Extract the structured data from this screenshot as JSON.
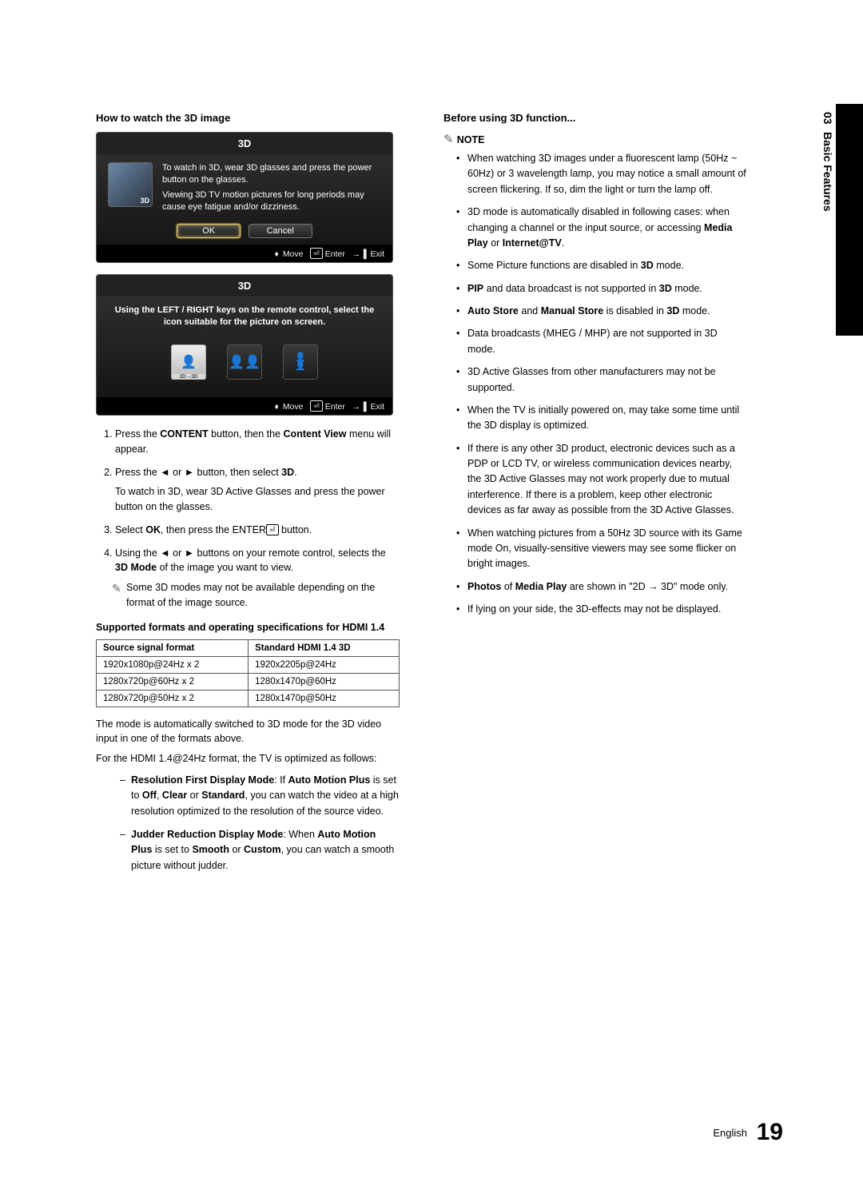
{
  "chapter": {
    "num": "03",
    "label": "Basic Features"
  },
  "left": {
    "heading": "How to watch the 3D image",
    "dialog1": {
      "title": "3D",
      "line1": "To watch in 3D, wear 3D glasses and press the power button on the glasses.",
      "line2": "Viewing 3D TV motion pictures for long periods may cause eye fatigue and/or dizziness.",
      "ok": "OK",
      "cancel": "Cancel",
      "footer_move": "Move",
      "footer_enter": "Enter",
      "footer_exit": "Exit"
    },
    "dialog2": {
      "title": "3D",
      "text": "Using the LEFT / RIGHT keys on the remote control, select the icon suitable for the picture on screen.",
      "footer_move": "Move",
      "footer_enter": "Enter",
      "footer_exit": "Exit",
      "icon1": "2d-to-3d-icon",
      "icon2": "side-by-side-icon",
      "icon3": "top-bottom-icon"
    },
    "steps": [
      {
        "pre": "Press the ",
        "b1": "CONTENT",
        "mid": " button, then the ",
        "b2": "Content View",
        "post": " menu will appear."
      },
      {
        "text": "Press the ◄ or ► button, then select ",
        "b": "3D",
        "post2": ".",
        "extra": "To watch in 3D, wear 3D Active Glasses and press the power button on the glasses."
      },
      {
        "pre": "Select ",
        "b1": "OK",
        "mid": ", then press the ENTER",
        "post": " button."
      },
      {
        "pre": "Using the ◄ or ► buttons on your remote control, selects the ",
        "b1": "3D Mode",
        "post": " of the image you want to view.",
        "subnote": "Some 3D modes may not be available depending on the format of the image source."
      }
    ],
    "formats_heading": "Supported formats and operating specifications for HDMI 1.4",
    "table": {
      "h1": "Source signal format",
      "h2": "Standard HDMI 1.4 3D",
      "rows": [
        [
          "1920x1080p@24Hz x 2",
          "1920x2205p@24Hz"
        ],
        [
          "1280x720p@60Hz x 2",
          "1280x1470p@60Hz"
        ],
        [
          "1280x720p@50Hz x 2",
          "1280x1470p@50Hz"
        ]
      ]
    },
    "after_table_1": "The mode is automatically switched to 3D mode for the 3D video input in one of the formats above.",
    "after_table_2": "For the HDMI 1.4@24Hz format, the TV is optimized as follows:",
    "modes": [
      {
        "b": "Resolution First Display Mode",
        "mid": ": If ",
        "b2": "Auto Motion Plus",
        "mid2": " is set to ",
        "b3": "Off",
        "sep1": ", ",
        "b4": "Clear",
        "sep2": " or ",
        "b5": "Standard",
        "post": ", you can watch the video at a high resolution optimized to the resolution of the source video."
      },
      {
        "b": "Judder Reduction Display Mode",
        "mid": ": When ",
        "b2": "Auto Motion Plus",
        "mid2": " is set to ",
        "b3": "Smooth",
        "sep1": " or ",
        "b4": "Custom",
        "post": ", you can watch a smooth picture without judder."
      }
    ]
  },
  "right": {
    "heading": "Before using 3D function...",
    "note_label": "NOTE",
    "bullets": [
      "When watching 3D images under a fluorescent lamp (50Hz ~ 60Hz) or 3 wavelength lamp, you may notice a small amount of screen flickering. If so, dim the light or turn the lamp off.",
      "3D mode is automatically disabled in following cases: when changing a channel or the input source, or accessing <b>Media Play</b> or <b>Internet@TV</b>.",
      "Some Picture functions are disabled in <b>3D</b> mode.",
      "<b>PIP</b> and data broadcast is not supported in <b>3D</b> mode.",
      "<b>Auto Store</b> and <b>Manual Store</b> is disabled in <b>3D</b> mode.",
      "Data broadcasts (MHEG / MHP) are not supported in 3D mode.",
      "3D Active Glasses from other manufacturers may not be supported.",
      "When the TV is initially powered on, may take some time until the 3D display is optimized.",
      "If there is any other 3D product, electronic devices such as a PDP or LCD TV, or wireless communication devices nearby, the 3D Active Glasses may not work properly due to mutual interference. If there is a problem, keep other electronic devices as far away as possible from the 3D Active Glasses.",
      "When watching pictures from a 50Hz 3D source with its Game mode On, visually-sensitive viewers may see some flicker on bright images.",
      "<b>Photos</b> of <b>Media Play</b> are shown in \"2D → 3D\" mode only.",
      "If lying on your side, the 3D-effects may not be displayed."
    ]
  },
  "footer": {
    "lang": "English",
    "page": "19"
  }
}
